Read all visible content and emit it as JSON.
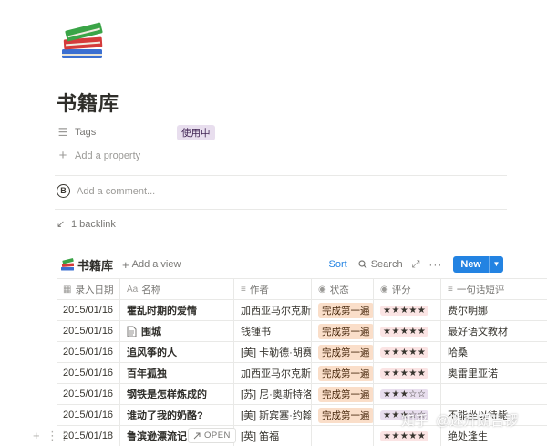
{
  "page": {
    "title": "书籍库",
    "icon": "books-icon"
  },
  "properties": [
    {
      "name": "Tags",
      "icon": "list-icon",
      "value": "使用中"
    }
  ],
  "add_property_label": "Add a property",
  "comment": {
    "avatar_letter": "B",
    "placeholder": "Add a comment..."
  },
  "backlink_label": "1 backlink",
  "database": {
    "title": "书籍库",
    "add_view_label": "Add a view",
    "sort_label": "Sort",
    "search_label": "Search",
    "new_label": "New",
    "columns": [
      "录入日期",
      "名称",
      "作者",
      "状态",
      "评分",
      "一句话短评"
    ],
    "rows": [
      {
        "date": "2015/01/16",
        "name": "霍乱时期的爱情",
        "author": "加西亚马尔克斯",
        "status": "完成第一遍",
        "rating": "★★★★★",
        "review": "费尔明娜",
        "doc": false
      },
      {
        "date": "2015/01/16",
        "name": "围城",
        "author": "钱锺书",
        "status": "完成第一遍",
        "rating": "★★★★★",
        "review": "最好语文教材",
        "doc": true
      },
      {
        "date": "2015/01/16",
        "name": "追风筝的人",
        "author": "[美] 卡勒德·胡赛尼",
        "status": "完成第一遍",
        "rating": "★★★★★",
        "review": "哈桑",
        "doc": false
      },
      {
        "date": "2015/01/16",
        "name": "百年孤独",
        "author": "加西亚马尔克斯",
        "status": "完成第一遍",
        "rating": "★★★★★",
        "review": "奥雷里亚诺",
        "doc": false
      },
      {
        "date": "2015/01/16",
        "name": "钢铁是怎样炼成的",
        "author": "[苏] 尼·奥斯特洛夫",
        "status": "完成第一遍",
        "rating": "★★★☆☆",
        "review": "",
        "doc": false
      },
      {
        "date": "2015/01/16",
        "name": "谁动了我的奶酪?",
        "author": "[美] 斯宾塞·约翰逊",
        "status": "完成第一遍",
        "rating": "★★★☆☆",
        "review": "不能坐以待毙",
        "doc": false
      },
      {
        "date": "2015/01/18",
        "name": "鲁滨逊漂流记",
        "author": "[英] 笛福",
        "status": "",
        "rating": "★★★★★",
        "review": "绝处逢生",
        "doc": false
      }
    ],
    "open_label": "OPEN"
  },
  "watermark": {
    "site": "知乎",
    "user": "@迷升朗吉锣"
  },
  "colors": {
    "accent": "#2383e2",
    "status_bg": "#fadec9",
    "rating_bg": "#fbe4e4",
    "tag_bg": "#e8deee"
  }
}
